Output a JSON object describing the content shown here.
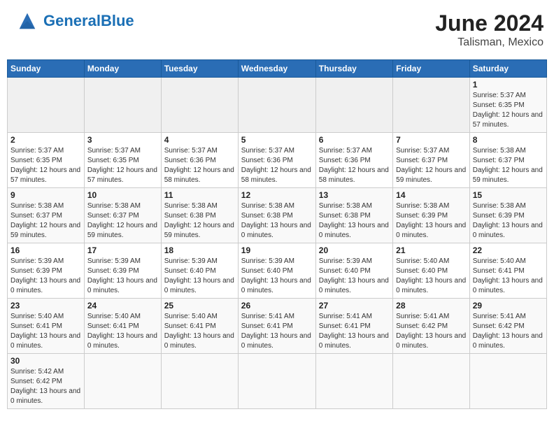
{
  "header": {
    "logo_text_regular": "General",
    "logo_text_blue": "Blue",
    "title": "June 2024",
    "subtitle": "Talisman, Mexico"
  },
  "weekdays": [
    "Sunday",
    "Monday",
    "Tuesday",
    "Wednesday",
    "Thursday",
    "Friday",
    "Saturday"
  ],
  "weeks": [
    [
      {
        "day": "",
        "info": ""
      },
      {
        "day": "",
        "info": ""
      },
      {
        "day": "",
        "info": ""
      },
      {
        "day": "",
        "info": ""
      },
      {
        "day": "",
        "info": ""
      },
      {
        "day": "",
        "info": ""
      },
      {
        "day": "1",
        "info": "Sunrise: 5:37 AM\nSunset: 6:35 PM\nDaylight: 12 hours and 57 minutes."
      }
    ],
    [
      {
        "day": "2",
        "info": "Sunrise: 5:37 AM\nSunset: 6:35 PM\nDaylight: 12 hours and 57 minutes."
      },
      {
        "day": "3",
        "info": "Sunrise: 5:37 AM\nSunset: 6:35 PM\nDaylight: 12 hours and 57 minutes."
      },
      {
        "day": "4",
        "info": "Sunrise: 5:37 AM\nSunset: 6:36 PM\nDaylight: 12 hours and 58 minutes."
      },
      {
        "day": "5",
        "info": "Sunrise: 5:37 AM\nSunset: 6:36 PM\nDaylight: 12 hours and 58 minutes."
      },
      {
        "day": "6",
        "info": "Sunrise: 5:37 AM\nSunset: 6:36 PM\nDaylight: 12 hours and 58 minutes."
      },
      {
        "day": "7",
        "info": "Sunrise: 5:37 AM\nSunset: 6:37 PM\nDaylight: 12 hours and 59 minutes."
      },
      {
        "day": "8",
        "info": "Sunrise: 5:38 AM\nSunset: 6:37 PM\nDaylight: 12 hours and 59 minutes."
      }
    ],
    [
      {
        "day": "9",
        "info": "Sunrise: 5:38 AM\nSunset: 6:37 PM\nDaylight: 12 hours and 59 minutes."
      },
      {
        "day": "10",
        "info": "Sunrise: 5:38 AM\nSunset: 6:37 PM\nDaylight: 12 hours and 59 minutes."
      },
      {
        "day": "11",
        "info": "Sunrise: 5:38 AM\nSunset: 6:38 PM\nDaylight: 12 hours and 59 minutes."
      },
      {
        "day": "12",
        "info": "Sunrise: 5:38 AM\nSunset: 6:38 PM\nDaylight: 13 hours and 0 minutes."
      },
      {
        "day": "13",
        "info": "Sunrise: 5:38 AM\nSunset: 6:38 PM\nDaylight: 13 hours and 0 minutes."
      },
      {
        "day": "14",
        "info": "Sunrise: 5:38 AM\nSunset: 6:39 PM\nDaylight: 13 hours and 0 minutes."
      },
      {
        "day": "15",
        "info": "Sunrise: 5:38 AM\nSunset: 6:39 PM\nDaylight: 13 hours and 0 minutes."
      }
    ],
    [
      {
        "day": "16",
        "info": "Sunrise: 5:39 AM\nSunset: 6:39 PM\nDaylight: 13 hours and 0 minutes."
      },
      {
        "day": "17",
        "info": "Sunrise: 5:39 AM\nSunset: 6:39 PM\nDaylight: 13 hours and 0 minutes."
      },
      {
        "day": "18",
        "info": "Sunrise: 5:39 AM\nSunset: 6:40 PM\nDaylight: 13 hours and 0 minutes."
      },
      {
        "day": "19",
        "info": "Sunrise: 5:39 AM\nSunset: 6:40 PM\nDaylight: 13 hours and 0 minutes."
      },
      {
        "day": "20",
        "info": "Sunrise: 5:39 AM\nSunset: 6:40 PM\nDaylight: 13 hours and 0 minutes."
      },
      {
        "day": "21",
        "info": "Sunrise: 5:40 AM\nSunset: 6:40 PM\nDaylight: 13 hours and 0 minutes."
      },
      {
        "day": "22",
        "info": "Sunrise: 5:40 AM\nSunset: 6:41 PM\nDaylight: 13 hours and 0 minutes."
      }
    ],
    [
      {
        "day": "23",
        "info": "Sunrise: 5:40 AM\nSunset: 6:41 PM\nDaylight: 13 hours and 0 minutes."
      },
      {
        "day": "24",
        "info": "Sunrise: 5:40 AM\nSunset: 6:41 PM\nDaylight: 13 hours and 0 minutes."
      },
      {
        "day": "25",
        "info": "Sunrise: 5:40 AM\nSunset: 6:41 PM\nDaylight: 13 hours and 0 minutes."
      },
      {
        "day": "26",
        "info": "Sunrise: 5:41 AM\nSunset: 6:41 PM\nDaylight: 13 hours and 0 minutes."
      },
      {
        "day": "27",
        "info": "Sunrise: 5:41 AM\nSunset: 6:41 PM\nDaylight: 13 hours and 0 minutes."
      },
      {
        "day": "28",
        "info": "Sunrise: 5:41 AM\nSunset: 6:42 PM\nDaylight: 13 hours and 0 minutes."
      },
      {
        "day": "29",
        "info": "Sunrise: 5:41 AM\nSunset: 6:42 PM\nDaylight: 13 hours and 0 minutes."
      }
    ],
    [
      {
        "day": "30",
        "info": "Sunrise: 5:42 AM\nSunset: 6:42 PM\nDaylight: 13 hours and 0 minutes."
      },
      {
        "day": "",
        "info": ""
      },
      {
        "day": "",
        "info": ""
      },
      {
        "day": "",
        "info": ""
      },
      {
        "day": "",
        "info": ""
      },
      {
        "day": "",
        "info": ""
      },
      {
        "day": "",
        "info": ""
      }
    ]
  ]
}
